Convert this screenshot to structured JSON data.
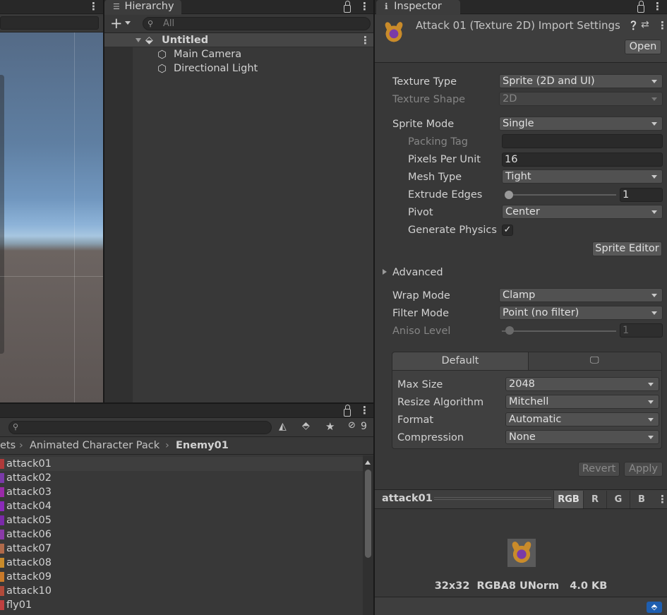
{
  "hierarchy": {
    "tab_title": "Hierarchy",
    "search_placeholder": "All",
    "scene_name": "Untitled",
    "items": [
      {
        "label": "Main Camera"
      },
      {
        "label": "Directional Light"
      }
    ]
  },
  "project": {
    "hidden_count": "9",
    "breadcrumb": [
      "ets",
      "Animated Character Pack",
      "Enemy01"
    ],
    "files": [
      {
        "name": "attack01",
        "color": "#b03a3a"
      },
      {
        "name": "attack02",
        "color": "#7a3aa8"
      },
      {
        "name": "attack03",
        "color": "#9a2aa8"
      },
      {
        "name": "attack04",
        "color": "#8a2ab8"
      },
      {
        "name": "attack05",
        "color": "#7a2aa8"
      },
      {
        "name": "attack06",
        "color": "#8a3aa8"
      },
      {
        "name": "attack07",
        "color": "#b06a4a"
      },
      {
        "name": "attack08",
        "color": "#c98b2a"
      },
      {
        "name": "attack09",
        "color": "#c97a2a"
      },
      {
        "name": "attack10",
        "color": "#b04a3a"
      },
      {
        "name": "fly01",
        "color": "#c04040"
      }
    ]
  },
  "inspector": {
    "tab_title": "Inspector",
    "title": "Attack 01 (Texture 2D) Import Settings",
    "open_label": "Open",
    "fields": {
      "texture_type": {
        "label": "Texture Type",
        "value": "Sprite (2D and UI)"
      },
      "texture_shape": {
        "label": "Texture Shape",
        "value": "2D"
      },
      "sprite_mode": {
        "label": "Sprite Mode",
        "value": "Single"
      },
      "packing_tag": {
        "label": "Packing Tag",
        "value": ""
      },
      "pixels_per_unit": {
        "label": "Pixels Per Unit",
        "value": "16"
      },
      "mesh_type": {
        "label": "Mesh Type",
        "value": "Tight"
      },
      "extrude_edges": {
        "label": "Extrude Edges",
        "value": "1"
      },
      "pivot": {
        "label": "Pivot",
        "value": "Center"
      },
      "generate_physics": {
        "label": "Generate Physics",
        "checked": true
      },
      "wrap_mode": {
        "label": "Wrap Mode",
        "value": "Clamp"
      },
      "filter_mode": {
        "label": "Filter Mode",
        "value": "Point (no filter)"
      },
      "aniso_level": {
        "label": "Aniso Level",
        "value": "1"
      }
    },
    "sprite_editor_label": "Sprite Editor",
    "advanced_label": "Advanced",
    "platform": {
      "default_tab": "Default",
      "fields": {
        "max_size": {
          "label": "Max Size",
          "value": "2048"
        },
        "resize_algorithm": {
          "label": "Resize Algorithm",
          "value": "Mitchell"
        },
        "format": {
          "label": "Format",
          "value": "Automatic"
        },
        "compression": {
          "label": "Compression",
          "value": "None"
        }
      }
    },
    "revert_label": "Revert",
    "apply_label": "Apply",
    "preview": {
      "name": "attack01",
      "channels": [
        "RGB",
        "R",
        "G",
        "B"
      ],
      "info": "32x32  RGBA8 UNorm   4.0 KB"
    }
  }
}
